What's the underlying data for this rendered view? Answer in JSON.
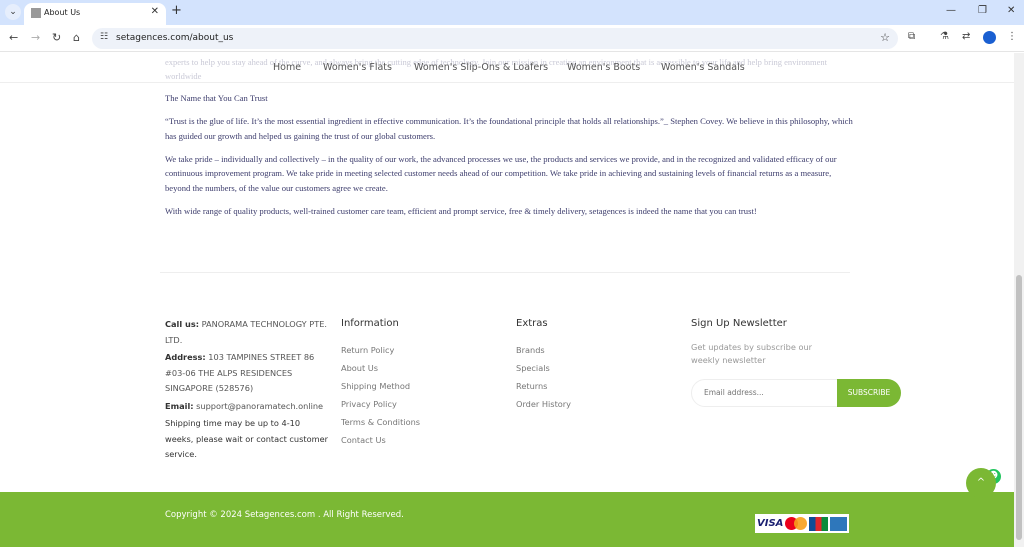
{
  "browser": {
    "tab_title": "About Us",
    "url": "setagences.com/about_us"
  },
  "faded_text": "experts to help you stay ahead of the curve, and always bring the cutting edge of technology. Join our mission in creating an environment that is accessible to your life and help bring environment worldwide",
  "menu": [
    "Home",
    "Women's Flats",
    "Women's Slip-Ons & Loafers",
    "Women's Boots",
    "Women's Sandals"
  ],
  "content": {
    "heading": "The Name that You Can Trust",
    "paragraphs": [
      "“Trust is the glue of life. It’s the most essential ingredient in effective communication. It’s the foundational principle that holds all relationships.”_ Stephen Covey. We believe in this philosophy, which has guided our growth and helped us gaining the trust of our global customers.",
      "We take pride – individually and collectively – in the quality of our work, the advanced processes we use, the products and services we provide, and in the recognized and validated efficacy of our continuous improvement program. We take pride in meeting selected customer needs ahead of our competition. We take pride in achieving and sustaining levels of financial returns as a measure, beyond the numbers, of the value our customers agree we create.",
      "With wide range of quality products, well-trained customer care team, efficient and prompt service, free & timely delivery, setagences is indeed the name that you can trust!"
    ]
  },
  "contact": {
    "call_label": "Call us:",
    "call_value": "PANORAMA TECHNOLOGY PTE. LTD.",
    "address_label": "Address:",
    "address_value": "103 TAMPINES STREET 86 #03-06 THE ALPS RESIDENCES SINGAPORE (528576)",
    "email_label": "Email:",
    "email_value": "support@panoramatech.online",
    "shipping": "Shipping time may be up to 4-10 weeks, please wait or contact customer service."
  },
  "information": {
    "title": "Information",
    "links": [
      "Return Policy",
      "About Us",
      "Shipping Method",
      "Privacy Policy",
      "Terms & Conditions",
      "Contact Us"
    ]
  },
  "extras": {
    "title": "Extras",
    "links": [
      "Brands",
      "Specials",
      "Returns",
      "Order History"
    ]
  },
  "newsletter": {
    "title": "Sign Up Newsletter",
    "desc": "Get updates by subscribe our weekly newsletter",
    "placeholder": "Email address...",
    "button": "SUBSCRIBE"
  },
  "footer": {
    "copyright": "Copyright © 2024 Setagences.com . All Right Reserved.",
    "visa": "VISA"
  },
  "colors": {
    "accent": "#7bb834",
    "body_text": "#3c3c6c"
  }
}
